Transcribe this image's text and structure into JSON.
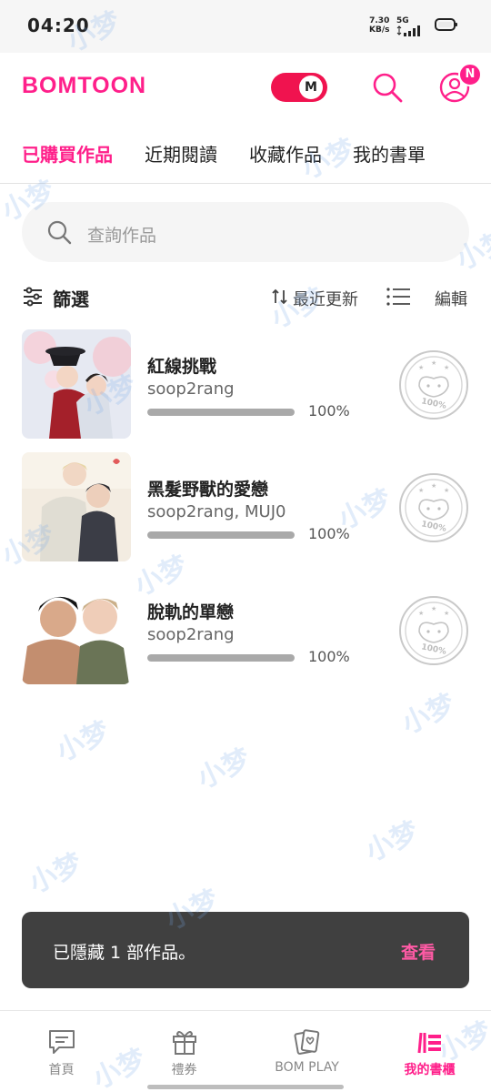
{
  "status_bar": {
    "time": "04:20",
    "net_speed": "7.30",
    "net_unit": "KB/s",
    "network": "5G"
  },
  "header": {
    "logo": "BOMTOON",
    "mode_badge": "M",
    "notification_badge": "N",
    "colors": {
      "brand": "#ff1f8a",
      "toggle": "#f0134f"
    }
  },
  "tabs": [
    {
      "label": "已購買作品",
      "active": true
    },
    {
      "label": "近期閱讀",
      "active": false
    },
    {
      "label": "收藏作品",
      "active": false
    },
    {
      "label": "我的書單",
      "active": false
    }
  ],
  "search": {
    "placeholder": "查詢作品"
  },
  "toolbar": {
    "filter_label": "篩選",
    "sort_label": "最近更新",
    "edit_label": "編輯"
  },
  "works": [
    {
      "title": "紅線挑戰",
      "author": "soop2rang",
      "progress_text": "100%",
      "progress": 1.0,
      "stamp_text": "100%"
    },
    {
      "title": "黑髮野獸的愛戀",
      "author": "soop2rang, MUJ0",
      "progress_text": "100%",
      "progress": 1.0,
      "stamp_text": "100%"
    },
    {
      "title": "脫軌的單戀",
      "author": "soop2rang",
      "progress_text": "100%",
      "progress": 1.0,
      "stamp_text": "100%"
    }
  ],
  "toast": {
    "message": "已隱藏 1 部作品。",
    "action": "查看"
  },
  "bottom_nav": [
    {
      "label": "首頁",
      "icon": "chat-home-icon",
      "active": false
    },
    {
      "label": "禮券",
      "icon": "gift-icon",
      "active": false
    },
    {
      "label": "BOM PLAY",
      "icon": "card-play-icon",
      "active": false
    },
    {
      "label": "我的書櫃",
      "icon": "bookshelf-icon",
      "active": true
    }
  ],
  "watermark": "小梦"
}
